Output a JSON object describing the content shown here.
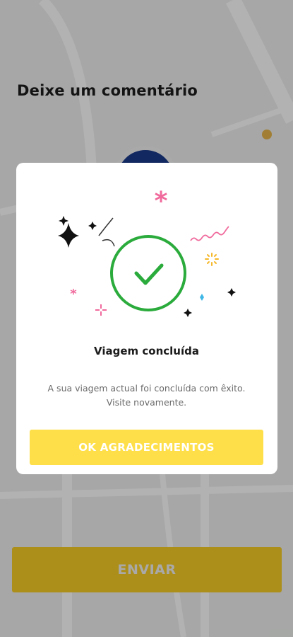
{
  "background": {
    "title": "Deixe um comentário",
    "send_button_label": "ENVIAR"
  },
  "dialog": {
    "title": "Viagem concluída",
    "message_line1": "A sua viagem actual foi concluída com êxito.",
    "message_line2": "Visite novamente.",
    "ok_button_label": "OK AGRADECIMENTOS"
  },
  "colors": {
    "accent": "#fedf49",
    "check_green": "#2bab3c",
    "confetti_pink": "#f06a9c",
    "confetti_orange": "#f5b82a",
    "confetti_blue": "#3fb7e6"
  }
}
